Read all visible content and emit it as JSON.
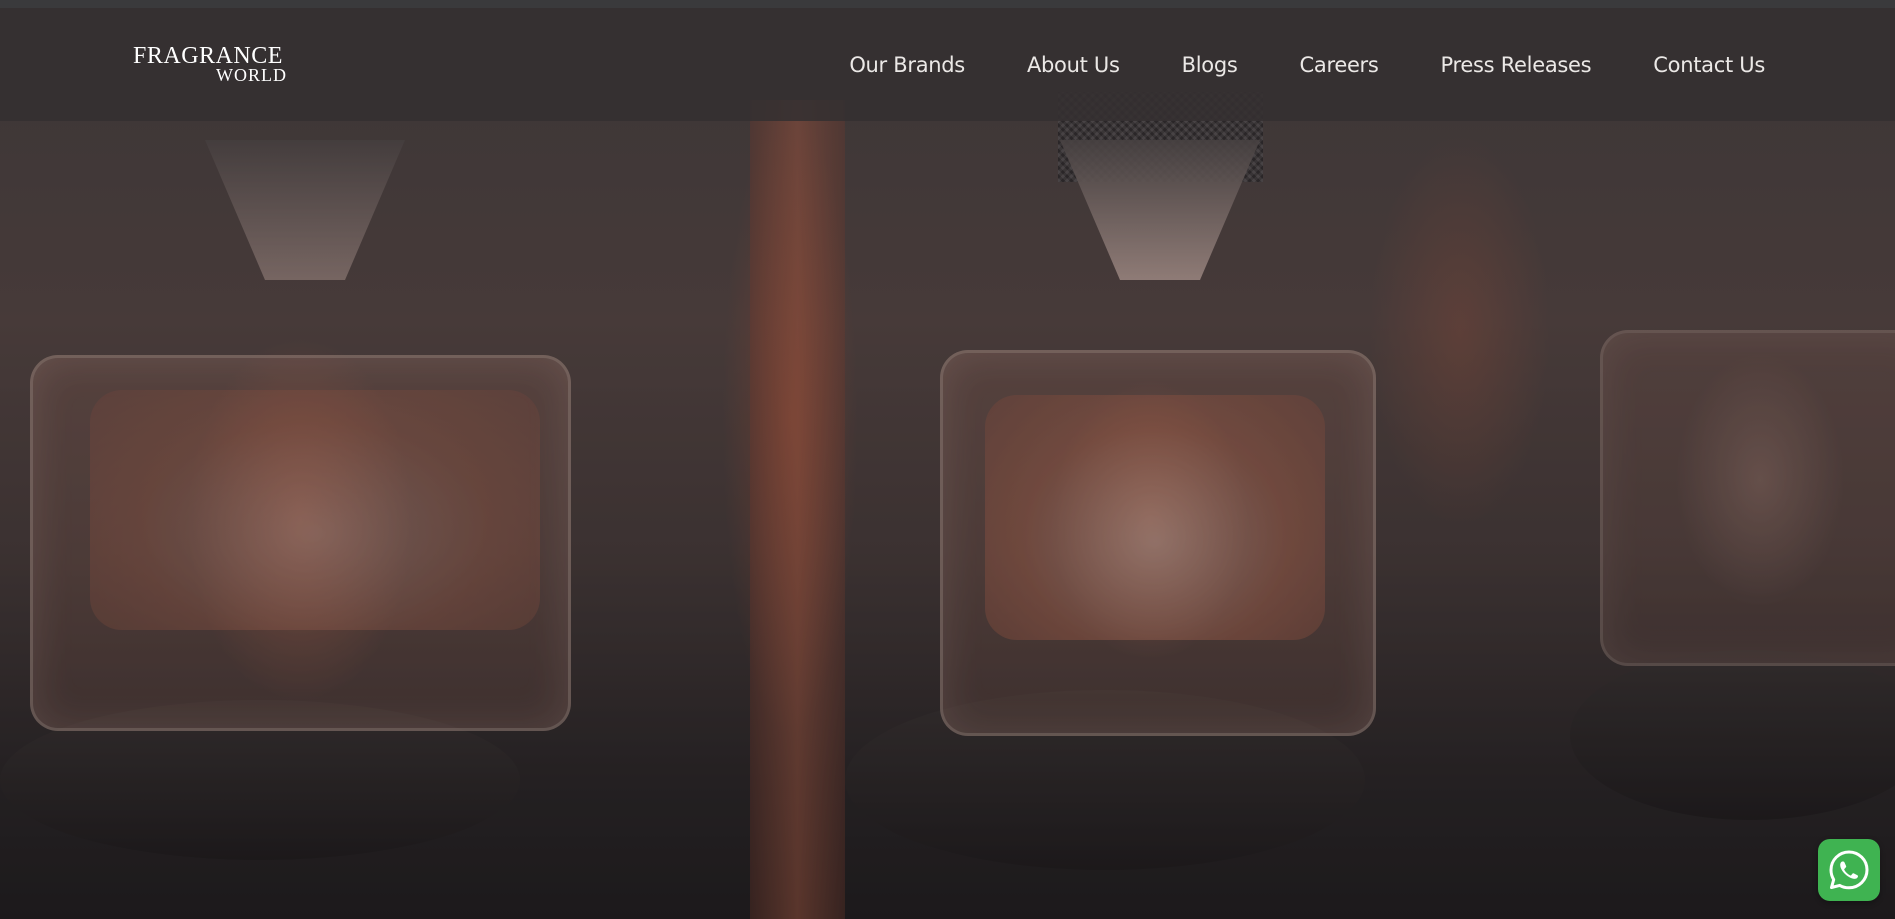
{
  "logo": {
    "line1": "FRAGRANCE",
    "line2": "WORLD"
  },
  "nav": {
    "items": [
      {
        "label": "Our Brands"
      },
      {
        "label": "About Us"
      },
      {
        "label": "Blogs"
      },
      {
        "label": "Careers"
      },
      {
        "label": "Press Releases"
      },
      {
        "label": "Contact Us"
      }
    ]
  },
  "floating": {
    "whatsapp_icon": "whatsapp-icon"
  },
  "colors": {
    "header_bg": "#343031",
    "nav_text": "#ebe8e6",
    "whatsapp": "#3fb351"
  }
}
